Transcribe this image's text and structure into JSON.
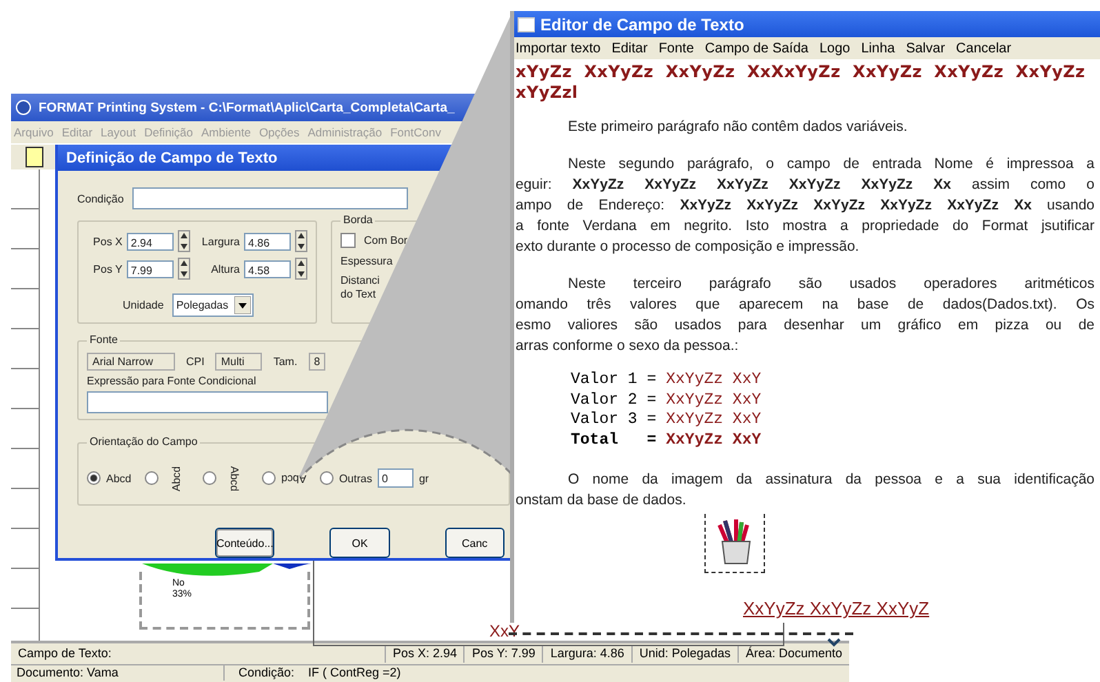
{
  "main_window": {
    "title": "FORMAT Printing System  -  C:\\Format\\Aplic\\Carta_Completa\\Carta_",
    "menu": [
      "Arquivo",
      "Editar",
      "Layout",
      "Definição",
      "Ambiente",
      "Opções",
      "Administração",
      "FontConv"
    ],
    "canvas": {
      "pie_labels": [
        "No",
        "33%"
      ],
      "overlapped_text": "XxY"
    },
    "status_bar": [
      "Campo de Texto:",
      "Pos X: 2.94",
      "Pos Y: 7.99",
      "Largura: 4.86",
      "Unid: Polegadas",
      "Área: Documento"
    ],
    "info_bar": {
      "document": "Documento: Vama",
      "condition_label": "Condição:",
      "condition": "IF ( ContReg =2)"
    }
  },
  "dialog": {
    "title": "Definição de Campo de Texto",
    "condition": {
      "label": "Condição"
    },
    "position": [
      {
        "label": "Pos X",
        "value": "2.94"
      },
      {
        "label": "Largura",
        "value": "4.86"
      },
      {
        "label": "Pos Y",
        "value": "7.99"
      },
      {
        "label": "Altura",
        "value": "4.58"
      }
    ],
    "unit": {
      "label": "Unidade",
      "value": "Polegadas"
    },
    "border": {
      "title": "Borda",
      "checkbox": {
        "label": "Com Bor",
        "checked": false
      },
      "thickness_label": "Espessura",
      "distance_lines": [
        "Distanci",
        "do Text"
      ]
    },
    "font": {
      "title": "Fonte",
      "name": "Arial Narrow",
      "cpi_label": "CPI",
      "cpi": "Multi",
      "size_label": "Tam.",
      "size": "8"
    },
    "conditional_font": {
      "label": "Expressão para Fonte Condicional"
    },
    "orientation": {
      "title": "Orientação do Campo",
      "options": [
        {
          "kind": "normal",
          "label": "Abcd",
          "selected": true
        },
        {
          "kind": "up",
          "label": "Abcd",
          "selected": false
        },
        {
          "kind": "down",
          "label": "Abcd",
          "selected": false
        },
        {
          "kind": "flipped",
          "label": "Abcd",
          "selected": false
        },
        {
          "kind": "other",
          "label": "Outras",
          "value": "0",
          "unit": "gr",
          "selected": false
        }
      ]
    },
    "buttons": [
      "Conteúdo...",
      "OK",
      "Canc"
    ]
  },
  "editor": {
    "title": "Editor de Campo de Texto",
    "menu": [
      "Importar texto",
      "Editar",
      "Fonte",
      "Campo de Saída",
      "Logo",
      "Linha",
      "Salvar",
      "Cancelar"
    ],
    "header_lines": [
      "xYyZz  XxYyZz  XxYyZz  XxXxYyZz  XxYyZz  XxYyZz  XxYyZz",
      "xYyZzl"
    ],
    "blocks": [
      {
        "kind": "text",
        "lines": [
          "Este primeiro parágrafo não contêm dados variáveis."
        ]
      },
      {
        "kind": "text",
        "lines": [
          "Neste segundo parágrafo, o campo de entrada Nome é impressoa a",
          "eguir: **XxYyZz XxYyZz XxYyZz XxYyZz XxYyZz Xx** assim como o",
          "ampo de Endereço: **XxYyZz XxYyZz XxYyZz XxYyZz XxYyZz Xx** usando",
          "a fonte Verdana em negrito. Isto mostra a propriedade do Format jsutificar",
          "exto durante o processo de composição e impressão."
        ]
      },
      {
        "kind": "text",
        "lines": [
          "Neste terceiro parágrafo são usados operadores aritméticos",
          "omando três valores que aparecem na base de dados(Dados.txt). Os",
          "esmo valiores são usados para desenhar um gráfico em pizza ou de",
          "arras conforme o sexo da pessoa.:"
        ]
      },
      {
        "kind": "values",
        "rows": [
          {
            "label": "Valor 1 =",
            "value": "XxYyZz XxY",
            "bold": false
          },
          {
            "label": "Valor 2 =",
            "value": "XxYyZz XxY",
            "bold": false
          },
          {
            "label": "Valor 3 =",
            "value": "XxYyZz XxY",
            "bold": false
          },
          {
            "label": "Total   =",
            "value": "XxYyZz XxY",
            "bold": true
          }
        ]
      },
      {
        "kind": "text",
        "lines": [
          "O nome da imagem da assinatura da pessoa e a sua identificação",
          "onstam da base de dados."
        ]
      },
      {
        "kind": "image"
      },
      {
        "kind": "heading",
        "lines": [
          "XxYyZz XxYyZz XxYyZ"
        ]
      }
    ]
  }
}
